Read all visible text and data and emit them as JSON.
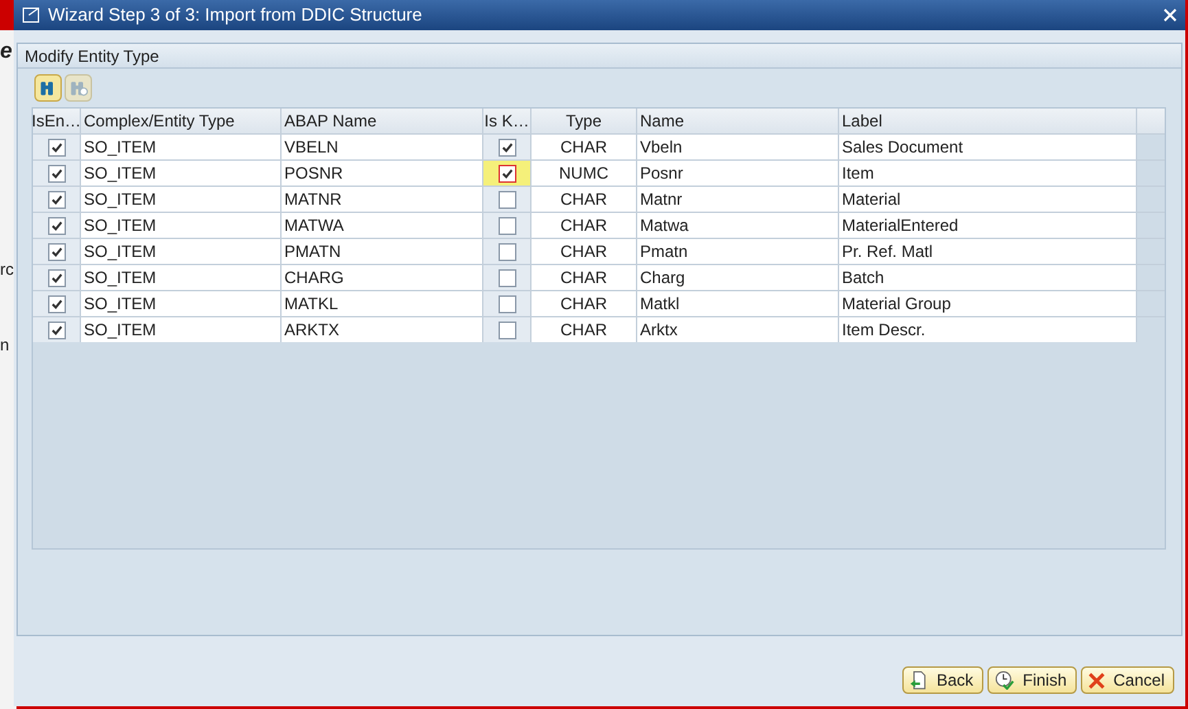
{
  "window": {
    "title": "Wizard Step 3 of 3: Import from DDIC Structure"
  },
  "background_window": {
    "fragments": [
      "e",
      "rc",
      "n"
    ]
  },
  "panel": {
    "title": "Modify Entity Type"
  },
  "toolbar": [
    {
      "kind": "find",
      "disabled": false
    },
    {
      "kind": "find-next",
      "disabled": true
    }
  ],
  "table": {
    "columns": [
      "IsEn…",
      "Complex/Entity Type",
      "ABAP Name",
      "Is K…",
      "Type",
      "Name",
      "Label"
    ],
    "rows": [
      {
        "is_entity": true,
        "entity_type": "SO_ITEM",
        "abap_name": "VBELN",
        "is_key": true,
        "focused": false,
        "type": "CHAR",
        "name": "Vbeln",
        "label": "Sales Document"
      },
      {
        "is_entity": true,
        "entity_type": "SO_ITEM",
        "abap_name": "POSNR",
        "is_key": true,
        "focused": true,
        "type": "NUMC",
        "name": "Posnr",
        "label": "Item"
      },
      {
        "is_entity": true,
        "entity_type": "SO_ITEM",
        "abap_name": "MATNR",
        "is_key": false,
        "focused": false,
        "type": "CHAR",
        "name": "Matnr",
        "label": "Material"
      },
      {
        "is_entity": true,
        "entity_type": "SO_ITEM",
        "abap_name": "MATWA",
        "is_key": false,
        "focused": false,
        "type": "CHAR",
        "name": "Matwa",
        "label": "MaterialEntered"
      },
      {
        "is_entity": true,
        "entity_type": "SO_ITEM",
        "abap_name": "PMATN",
        "is_key": false,
        "focused": false,
        "type": "CHAR",
        "name": "Pmatn",
        "label": "Pr. Ref. Matl"
      },
      {
        "is_entity": true,
        "entity_type": "SO_ITEM",
        "abap_name": "CHARG",
        "is_key": false,
        "focused": false,
        "type": "CHAR",
        "name": "Charg",
        "label": "Batch"
      },
      {
        "is_entity": true,
        "entity_type": "SO_ITEM",
        "abap_name": "MATKL",
        "is_key": false,
        "focused": false,
        "type": "CHAR",
        "name": "Matkl",
        "label": "Material Group"
      },
      {
        "is_entity": true,
        "entity_type": "SO_ITEM",
        "abap_name": "ARKTX",
        "is_key": false,
        "focused": false,
        "type": "CHAR",
        "name": "Arktx",
        "label": "Item Descr."
      }
    ]
  },
  "buttons": [
    {
      "kind": "back",
      "label": "Back"
    },
    {
      "kind": "finish",
      "label": "Finish"
    },
    {
      "kind": "cancel",
      "label": "Cancel"
    }
  ]
}
